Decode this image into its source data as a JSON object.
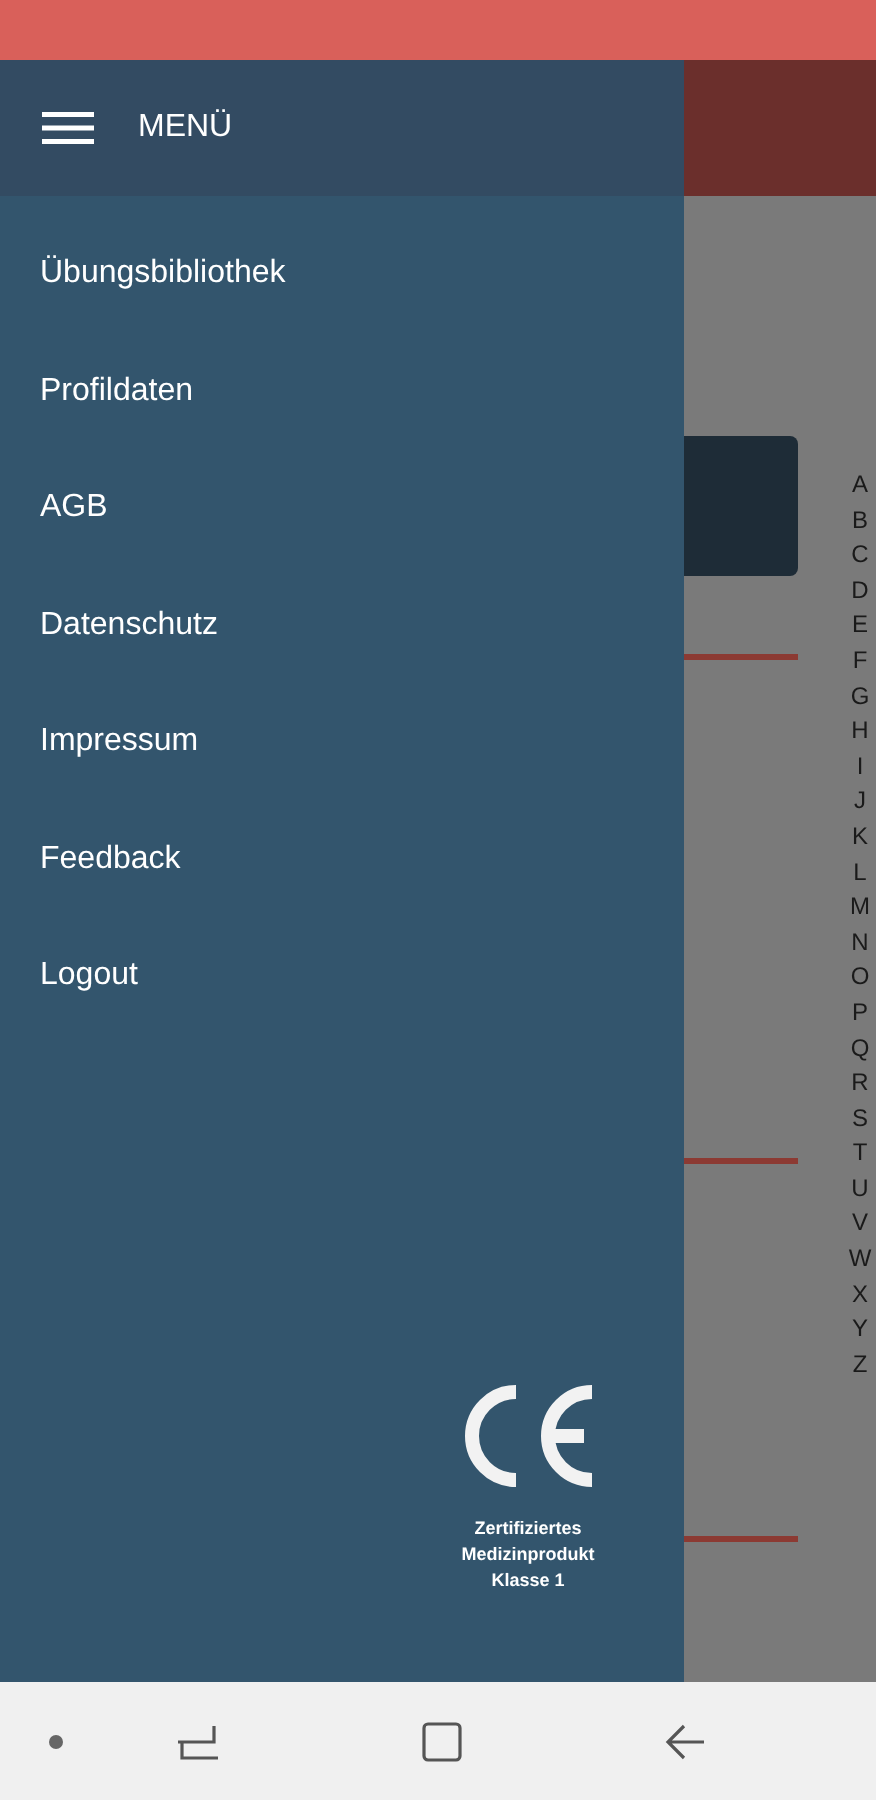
{
  "drawer": {
    "title": "MENÜ",
    "items": [
      "Übungsbibliothek",
      "Profildaten",
      "AGB",
      "Datenschutz",
      "Impressum",
      "Feedback",
      "Logout"
    ],
    "certification": [
      "Zertifiziertes",
      "Medizinprodukt",
      "Klasse 1"
    ]
  },
  "alphabet_index": [
    "A",
    "B",
    "C",
    "D",
    "E",
    "F",
    "G",
    "H",
    "I",
    "J",
    "K",
    "L",
    "M",
    "N",
    "O",
    "P",
    "Q",
    "R",
    "S",
    "T",
    "U",
    "V",
    "W",
    "X",
    "Y",
    "Z"
  ]
}
